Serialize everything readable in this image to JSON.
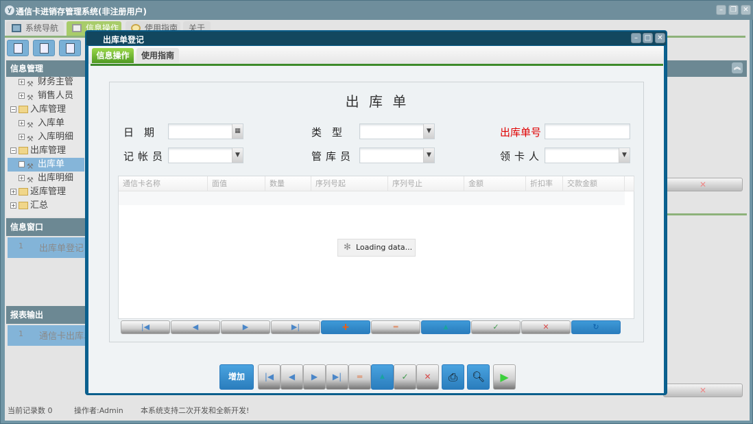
{
  "app": {
    "title": "通信卡进销存管理系统(非注册用户)"
  },
  "tabs": [
    {
      "label": "系统导航"
    },
    {
      "label": "信息操作",
      "active": true
    },
    {
      "label": "使用指南"
    },
    {
      "label": "关于"
    }
  ],
  "sidebar": {
    "info_header": "信息管理",
    "tree": [
      {
        "label": "财务主管",
        "level": 2,
        "icon": "tool-icon"
      },
      {
        "label": "销售人员",
        "level": 2,
        "icon": "tool-icon"
      },
      {
        "label": "入库管理",
        "level": 1,
        "icon": "folder-icon"
      },
      {
        "label": "入库单",
        "level": 2,
        "icon": "tool-icon"
      },
      {
        "label": "入库明细",
        "level": 2,
        "icon": "tool-icon"
      },
      {
        "label": "出库管理",
        "level": 1,
        "icon": "folder-icon"
      },
      {
        "label": "出库单",
        "level": 2,
        "icon": "tool-icon",
        "selected": true
      },
      {
        "label": "出库明细",
        "level": 2,
        "icon": "tool-icon"
      },
      {
        "label": "返库管理",
        "level": 1,
        "icon": "folder-icon"
      },
      {
        "label": "汇总",
        "level": 1,
        "icon": "folder-icon"
      }
    ],
    "window_header": "信息窗口",
    "window_rows": [
      {
        "num": "1",
        "label": "出库单登记"
      }
    ],
    "report_header": "报表输出",
    "report_rows": [
      {
        "num": "1",
        "label": "通信卡出库单"
      }
    ]
  },
  "status": {
    "records": "当前记录数 0",
    "operator": "操作者:Admin",
    "note": "本系统支持二次开发和全新开发!"
  },
  "modal": {
    "title": "出库单登记",
    "tabs": [
      {
        "label": "信息操作",
        "active": true
      },
      {
        "label": "使用指南"
      }
    ],
    "form_title": "出 库 单",
    "fields": {
      "date": {
        "label": "日　期",
        "value": ""
      },
      "type": {
        "label": "类　型",
        "value": ""
      },
      "order_no": {
        "label": "出库单号",
        "value": "",
        "color": "#e00000"
      },
      "bookkeeper": {
        "label": "记帐员",
        "value": ""
      },
      "keeper": {
        "label": "管库员",
        "value": ""
      },
      "receiver": {
        "label": "领卡人",
        "value": ""
      }
    },
    "grid": {
      "columns": [
        "通信卡名称",
        "面值",
        "数量",
        "序列号起",
        "序列号止",
        "金额",
        "折扣率",
        "交款金额"
      ],
      "loading": "Loading data..."
    },
    "add_label": "增加"
  },
  "colors": {
    "accent_blue": "#2a7dbd",
    "tab_green": "#6fb02a",
    "header_slate": "#6c8893"
  }
}
